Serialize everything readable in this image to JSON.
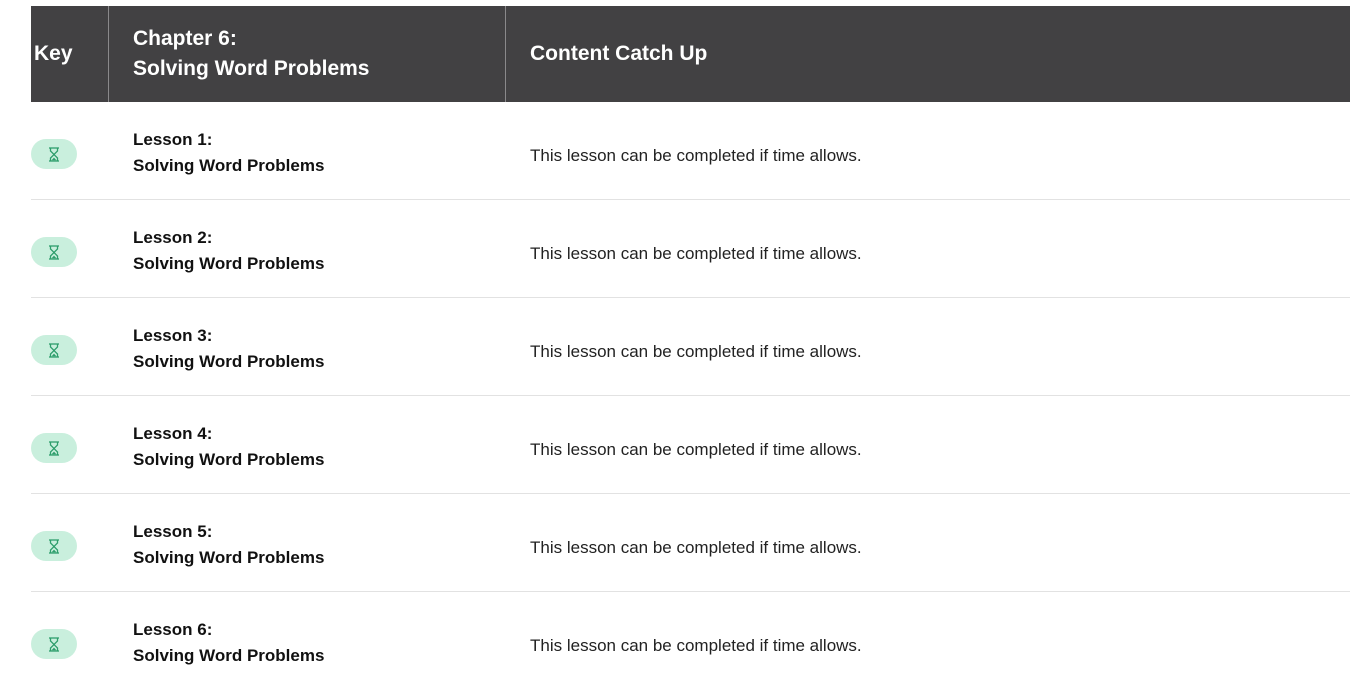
{
  "header": {
    "key_label": "Key",
    "chapter_line1": "Chapter 6:",
    "chapter_line2": "Solving Word Problems",
    "catch_label": "Content Catch Up"
  },
  "colors": {
    "header_bg": "#424143",
    "badge_bg": "#c9efdd",
    "badge_icon": "#2e9e6c"
  },
  "rows": [
    {
      "icon": "hourglass-icon",
      "lesson": "Lesson 1:",
      "title": "Solving Word Problems",
      "note": "This lesson can be completed if time allows."
    },
    {
      "icon": "hourglass-icon",
      "lesson": "Lesson 2:",
      "title": "Solving Word Problems",
      "note": "This lesson can be completed if time allows."
    },
    {
      "icon": "hourglass-icon",
      "lesson": "Lesson 3:",
      "title": "Solving Word Problems",
      "note": "This lesson can be completed if time allows."
    },
    {
      "icon": "hourglass-icon",
      "lesson": "Lesson 4:",
      "title": "Solving Word Problems",
      "note": "This lesson can be completed if time allows."
    },
    {
      "icon": "hourglass-icon",
      "lesson": "Lesson 5:",
      "title": "Solving Word Problems",
      "note": "This lesson can be completed if time allows."
    },
    {
      "icon": "hourglass-icon",
      "lesson": "Lesson 6:",
      "title": "Solving Word Problems",
      "note": "This lesson can be completed if time allows."
    }
  ]
}
